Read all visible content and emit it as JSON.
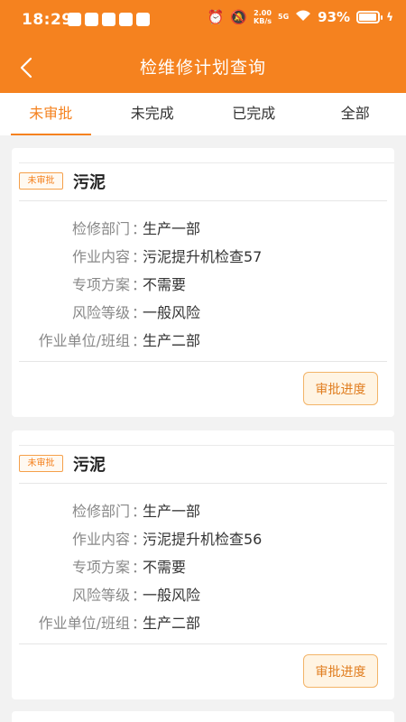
{
  "status_bar": {
    "time": "18:29",
    "net_speed_value": "2.00",
    "net_speed_unit": "KB/s",
    "network": "5G",
    "battery": "93%"
  },
  "header": {
    "title": "检维修计划查询",
    "back_icon": "chevron-left-icon",
    "background": "#f5821f"
  },
  "tabs": [
    {
      "label": "未审批",
      "active": true
    },
    {
      "label": "未完成",
      "active": false
    },
    {
      "label": "已完成",
      "active": false
    },
    {
      "label": "全部",
      "active": false
    }
  ],
  "labels": {
    "department": "检修部门",
    "content": "作业内容",
    "plan": "专项方案",
    "risk": "风险等级",
    "unit": "作业单位/班组",
    "colon": "："
  },
  "records": [
    {
      "badge": "未审批",
      "title": "污泥",
      "department": "生产一部",
      "content": "污泥提升机检查57",
      "plan": "不需要",
      "risk": "一般风险",
      "unit": "生产二部",
      "action": "审批进度"
    },
    {
      "badge": "未审批",
      "title": "污泥",
      "department": "生产一部",
      "content": "污泥提升机检查56",
      "plan": "不需要",
      "risk": "一般风险",
      "unit": "生产二部",
      "action": "审批进度"
    }
  ],
  "colors": {
    "accent": "#f5821f",
    "badge_border": "#f5a04a",
    "button_bg": "#fff4e3"
  }
}
